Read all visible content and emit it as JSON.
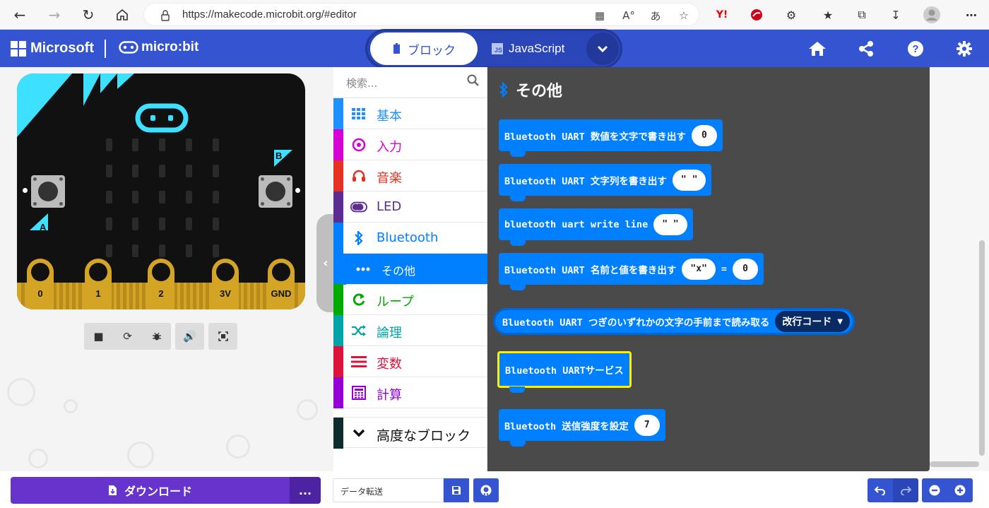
{
  "browser": {
    "url": "https://makecode.microsoft.org/#editor",
    "url_display": "https://makecode.microbit.org/#editor",
    "aa_label": "A°",
    "lang_label": "あ"
  },
  "header": {
    "brand": "Microsoft",
    "product": "micro:bit",
    "tab_blocks": "ブロック",
    "tab_js": "JavaScript",
    "js_badge": "JS"
  },
  "simulator": {
    "button_a": "A",
    "button_b": "B",
    "pins": [
      "0",
      "1",
      "2",
      "3V",
      "GND"
    ]
  },
  "toolbox": {
    "search_placeholder": "検索...",
    "categories": [
      {
        "label": "基本",
        "color": "#1e90ff",
        "icon": "grid-icon"
      },
      {
        "label": "入力",
        "color": "#d400d4",
        "icon": "target-icon"
      },
      {
        "label": "音楽",
        "color": "#e63022",
        "icon": "headphones-icon"
      },
      {
        "label": "LED",
        "color": "#5c2d91",
        "icon": "toggle-icon"
      },
      {
        "label": "Bluetooth",
        "color": "#007fff",
        "icon": "bluetooth-icon"
      },
      {
        "label": "その他",
        "color": "#007fff",
        "icon": "more-icon"
      },
      {
        "label": "ループ",
        "color": "#00aa00",
        "icon": "loop-icon"
      },
      {
        "label": "論理",
        "color": "#00a4a6",
        "icon": "shuffle-icon"
      },
      {
        "label": "変数",
        "color": "#dc143c",
        "icon": "lines-icon"
      },
      {
        "label": "計算",
        "color": "#9400d3",
        "icon": "calculator-icon"
      },
      {
        "label": "高度なブロック",
        "color": "#0d2d2d",
        "icon": "chevron-down-icon"
      }
    ]
  },
  "flyout": {
    "title": "その他",
    "blocks": [
      {
        "text": "Bluetooth UART 数値を文字で書き出す",
        "slot": "0"
      },
      {
        "text": "Bluetooth UART 文字列を書き出す",
        "slot": "\" \""
      },
      {
        "text": "bluetooth uart write line",
        "slot": "\" \""
      },
      {
        "text": "Bluetooth UART 名前と値を書き出す",
        "slot": "\"x\"",
        "eq": "=",
        "slot2": "0"
      },
      {
        "text": "Bluetooth UART つぎのいずれかの文字の手前まで読み取る",
        "dropdown": "改行コード"
      },
      {
        "text": "Bluetooth UARTサービス"
      },
      {
        "text": "Bluetooth 送信強度を設定",
        "slot": "7"
      }
    ]
  },
  "bottom": {
    "download_label": "ダウンロード",
    "more_label": "...",
    "project_name": "データ転送"
  }
}
